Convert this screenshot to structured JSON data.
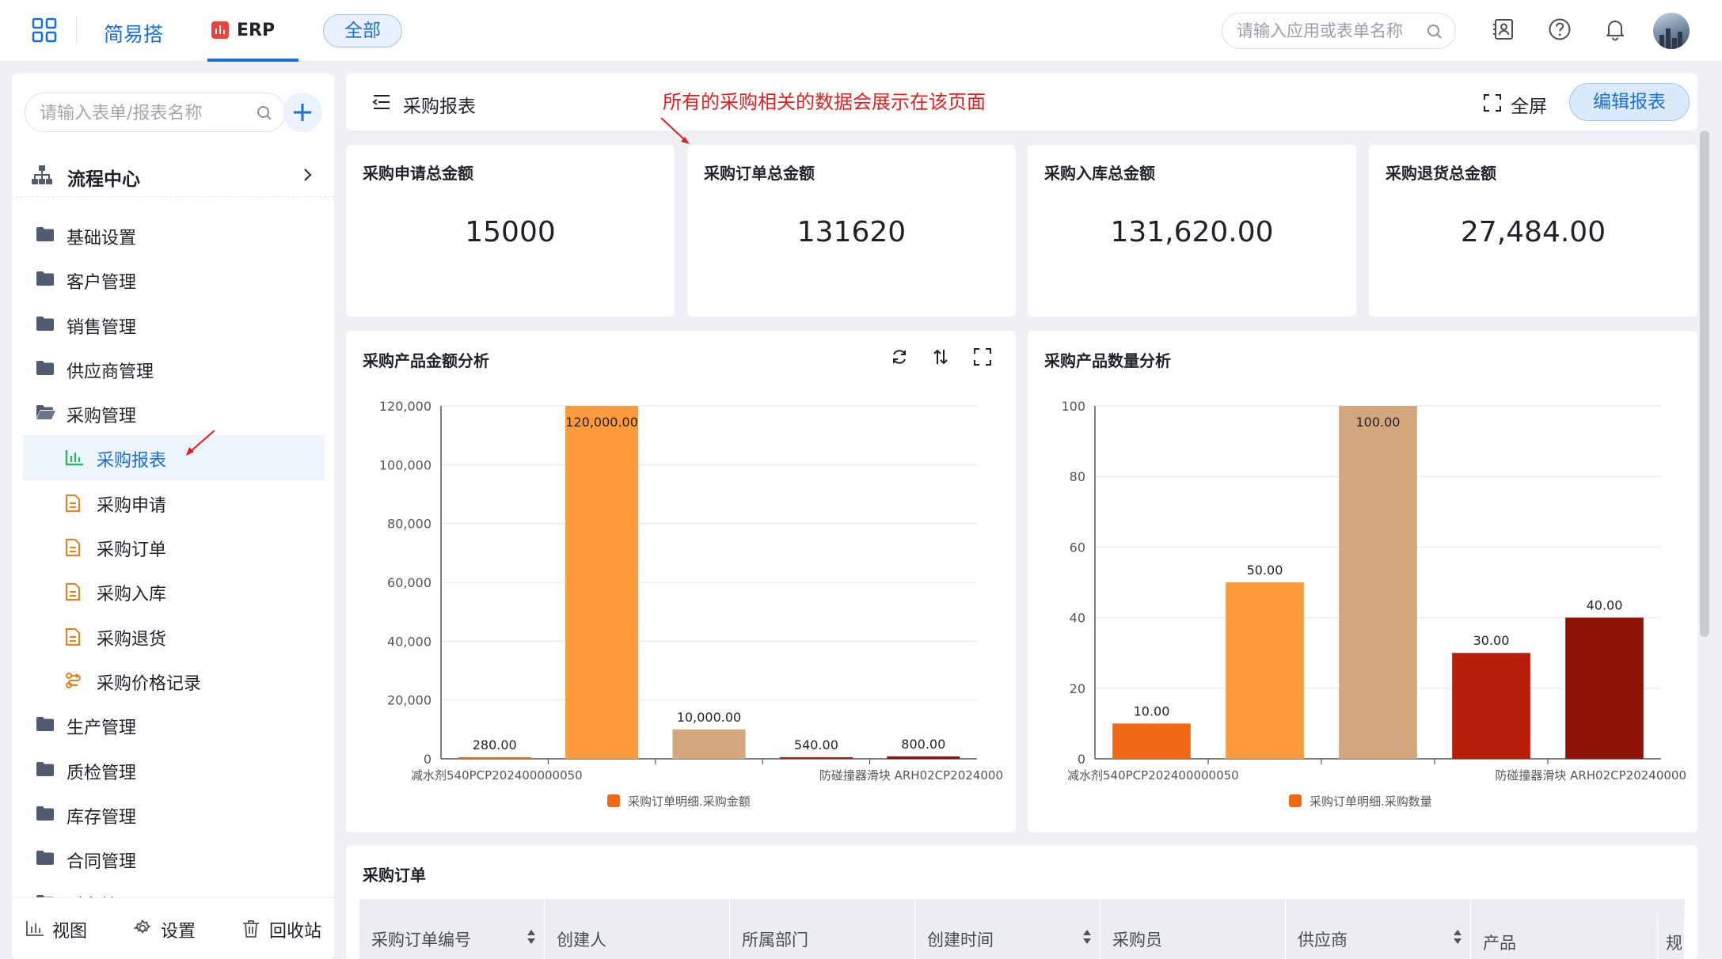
{
  "topbar": {
    "brand": "简易搭",
    "app_name": "ERP",
    "scope_label": "全部",
    "search_placeholder": "请输入应用或表单名称"
  },
  "sidebar": {
    "search_placeholder": "请输入表单/报表名称",
    "flow_center": "流程中心",
    "menu": [
      {
        "label": "基础设置",
        "icon": "folder-icon",
        "level": 0
      },
      {
        "label": "客户管理",
        "icon": "folder-icon",
        "level": 0
      },
      {
        "label": "销售管理",
        "icon": "folder-icon",
        "level": 0
      },
      {
        "label": "供应商管理",
        "icon": "folder-icon",
        "level": 0
      },
      {
        "label": "采购管理",
        "icon": "folder-open-icon",
        "level": 0
      },
      {
        "label": "采购报表",
        "icon": "bar-chart-icon",
        "level": 1,
        "active": true
      },
      {
        "label": "采购申请",
        "icon": "form-icon",
        "level": 1
      },
      {
        "label": "采购订单",
        "icon": "form-icon",
        "level": 1
      },
      {
        "label": "采购入库",
        "icon": "form-icon",
        "level": 1
      },
      {
        "label": "采购退货",
        "icon": "form-icon",
        "level": 1
      },
      {
        "label": "采购价格记录",
        "icon": "flow-icon",
        "level": 1
      },
      {
        "label": "生产管理",
        "icon": "folder-icon",
        "level": 0
      },
      {
        "label": "质检管理",
        "icon": "folder-icon",
        "level": 0
      },
      {
        "label": "库存管理",
        "icon": "folder-icon",
        "level": 0
      },
      {
        "label": "合同管理",
        "icon": "folder-icon",
        "level": 0
      },
      {
        "label": "财务管理",
        "icon": "folder-icon",
        "level": 0
      }
    ],
    "bottom": {
      "view": "视图",
      "settings": "设置",
      "recycle": "回收站"
    }
  },
  "header": {
    "title": "采购报表",
    "annotation": "所有的采购相关的数据会展示在该页面",
    "fullscreen": "全屏",
    "edit": "编辑报表"
  },
  "kpis": [
    {
      "title": "采购申请总金额",
      "value": "15000"
    },
    {
      "title": "采购订单总金额",
      "value": "131620"
    },
    {
      "title": "采购入库总金额",
      "value": "131,620.00"
    },
    {
      "title": "采购退货总金额",
      "value": "27,484.00"
    }
  ],
  "colors": {
    "primary": "#1a6fd6",
    "annotation": "#e02020",
    "bars": [
      "#ef6a12",
      "#fd9a3c",
      "#d4a67d",
      "#b71f0a",
      "#8e1407"
    ]
  },
  "chart_data": [
    {
      "type": "bar",
      "title": "采购产品金额分析",
      "categories": [
        "减水剂540PCP202400000050",
        "",
        "",
        "",
        "防碰撞器滑块 ARH02CP2024000"
      ],
      "values": [
        280,
        120000,
        10000,
        540,
        800
      ],
      "value_labels": [
        "280.00",
        "120,000.00",
        "10,000.00",
        "540.00",
        "800.00"
      ],
      "ylim": [
        0,
        120000
      ],
      "y_ticks": [
        0,
        20000,
        40000,
        60000,
        80000,
        100000,
        120000
      ],
      "y_tick_labels": [
        "0",
        "20,000",
        "40,000",
        "60,000",
        "80,000",
        "100,000",
        "120,000"
      ],
      "legend": "采购订单明细.采购金额",
      "legend_position": "bottom",
      "grid": true
    },
    {
      "type": "bar",
      "title": "采购产品数量分析",
      "categories": [
        "减水剂540PCP202400000050",
        "",
        "",
        "",
        "防碰撞器滑块 ARH02CP20240000"
      ],
      "values": [
        10,
        50,
        100,
        30,
        40
      ],
      "value_labels": [
        "10.00",
        "50.00",
        "100.00",
        "30.00",
        "40.00"
      ],
      "ylim": [
        0,
        100
      ],
      "y_ticks": [
        0,
        20,
        40,
        60,
        80,
        100
      ],
      "y_tick_labels": [
        "0",
        "20",
        "40",
        "60",
        "80",
        "100"
      ],
      "legend": "采购订单明细.采购数量",
      "legend_position": "bottom",
      "grid": true
    }
  ],
  "orders": {
    "title": "采购订单",
    "columns": [
      {
        "label": "采购订单编号",
        "sortable": true
      },
      {
        "label": "创建人",
        "sortable": false
      },
      {
        "label": "所属部门",
        "sortable": false
      },
      {
        "label": "创建时间",
        "sortable": true
      },
      {
        "label": "采购员",
        "sortable": false
      },
      {
        "label": "供应商",
        "sortable": true
      },
      {
        "label": "产品",
        "sortable": false
      },
      {
        "label": "规",
        "sortable": false
      }
    ]
  }
}
